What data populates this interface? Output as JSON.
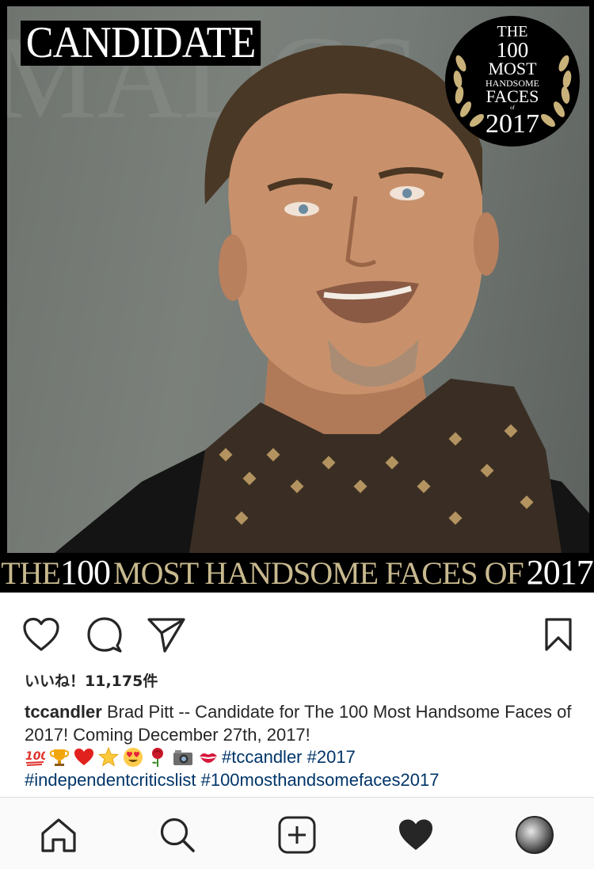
{
  "post": {
    "candidate_label": "CANDIDATE",
    "seal": {
      "the": "THE",
      "number": "100",
      "most": "MOST",
      "handsome": "HANDSOME",
      "faces": "FACES",
      "of": "of",
      "year": "2017"
    },
    "banner": {
      "the": "THE",
      "number": "100",
      "middle": "MOST HANDSOME FACES OF",
      "year": "2017"
    }
  },
  "actions": {
    "like_icon": "heart-outline-icon",
    "comment_icon": "comment-bubble-icon",
    "share_icon": "paper-plane-icon",
    "save_icon": "bookmark-icon"
  },
  "likes_text": "いいね！11,175件",
  "caption": {
    "username": "tccandler",
    "text": " Brad Pitt -- Candidate for The 100 Most Handsome Faces of 2017! Coming December 27th, 2017!",
    "emojis": [
      "hundred-points",
      "trophy",
      "red-heart",
      "star",
      "heart-eyes",
      "rose",
      "camera",
      "kiss-mark"
    ],
    "hashtags": [
      "#tccandler",
      "#2017",
      "#independentcriticslist",
      "#100mosthandsomefaces2017"
    ]
  },
  "tabbar": {
    "icons": [
      "home-icon",
      "search-icon",
      "new-post-icon",
      "activity-heart-icon",
      "profile-avatar"
    ]
  },
  "colors": {
    "text": "#262626",
    "hashtag": "#003569",
    "banner_gold": "#c8b98e",
    "tabbar_bg": "#fafafa"
  }
}
